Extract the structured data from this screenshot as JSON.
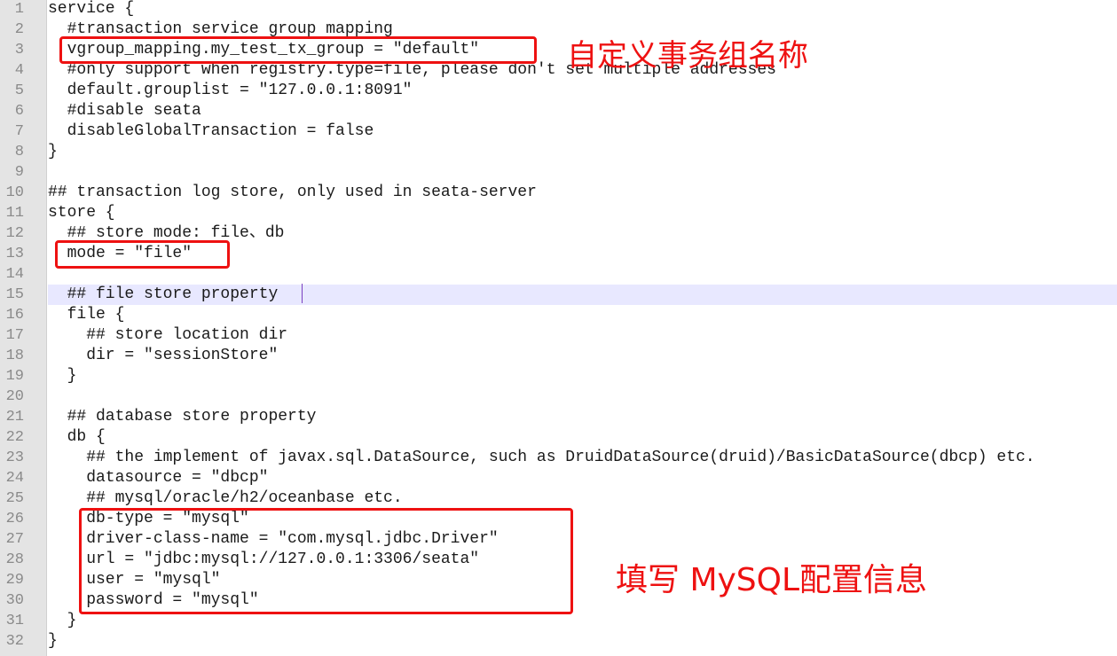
{
  "editor": {
    "line_numbers": [
      "1",
      "2",
      "3",
      "4",
      "5",
      "6",
      "7",
      "8",
      "9",
      "10",
      "11",
      "12",
      "13",
      "14",
      "15",
      "16",
      "17",
      "18",
      "19",
      "20",
      "21",
      "22",
      "23",
      "24",
      "25",
      "26",
      "27",
      "28",
      "29",
      "30",
      "31",
      "32"
    ],
    "lines": [
      "service {",
      "  #transaction service group mapping",
      "  vgroup_mapping.my_test_tx_group = \"default\"",
      "  #only support when registry.type=file, please don't set multiple addresses",
      "  default.grouplist = \"127.0.0.1:8091\"",
      "  #disable seata",
      "  disableGlobalTransaction = false",
      "}",
      "",
      "## transaction log store, only used in seata-server",
      "store {",
      "  ## store mode: file、db",
      "  mode = \"file\"",
      "",
      "  ## file store property",
      "  file {",
      "    ## store location dir",
      "    dir = \"sessionStore\"",
      "  }",
      "",
      "  ## database store property",
      "  db {",
      "    ## the implement of javax.sql.DataSource, such as DruidDataSource(druid)/BasicDataSource(dbcp) etc.",
      "    datasource = \"dbcp\"",
      "    ## mysql/oracle/h2/oceanbase etc.",
      "    db-type = \"mysql\"",
      "    driver-class-name = \"com.mysql.jdbc.Driver\"",
      "    url = \"jdbc:mysql://127.0.0.1:3306/seata\"",
      "    user = \"mysql\"",
      "    password = \"mysql\"",
      "  }",
      "}"
    ],
    "current_line": 15
  },
  "annotations": {
    "group_name_label": "自定义事务组名称",
    "mysql_config_label": "填写 MySQL配置信息",
    "color": "#ee1111"
  }
}
